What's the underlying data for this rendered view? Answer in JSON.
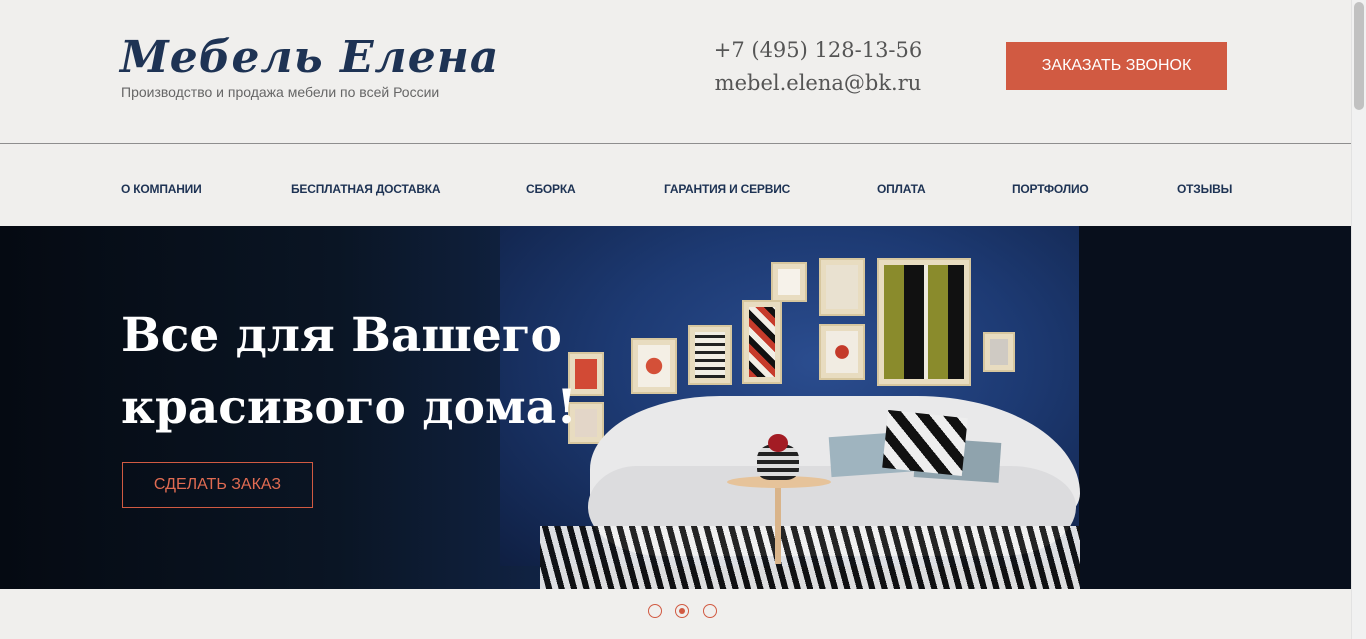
{
  "header": {
    "logo": "Мебель Елена",
    "tagline": "Производство и продажа мебели по всей России",
    "phone": "+7 (495) 128-13-56",
    "email": "mebel.elena@bk.ru",
    "call_button": "ЗАКАЗАТЬ ЗВОНОК"
  },
  "nav": {
    "items": [
      {
        "label": "О КОМПАНИИ"
      },
      {
        "label": "БЕСПЛАТНАЯ ДОСТАВКА"
      },
      {
        "label": "СБОРКА"
      },
      {
        "label": "ГАРАНТИЯ И СЕРВИС"
      },
      {
        "label": "ОПЛАТА"
      },
      {
        "label": "ПОРТФОЛИО"
      },
      {
        "label": "ОТЗЫВЫ"
      }
    ]
  },
  "hero": {
    "title_line1": "Все для Вашего",
    "title_line2": "красивого дома!",
    "order_button": "СДЕЛАТЬ ЗАКАЗ"
  },
  "slider": {
    "count": 3,
    "active_index": 1
  },
  "colors": {
    "accent": "#d15a42",
    "brand_dark": "#1e3354",
    "background": "#f0efed"
  }
}
